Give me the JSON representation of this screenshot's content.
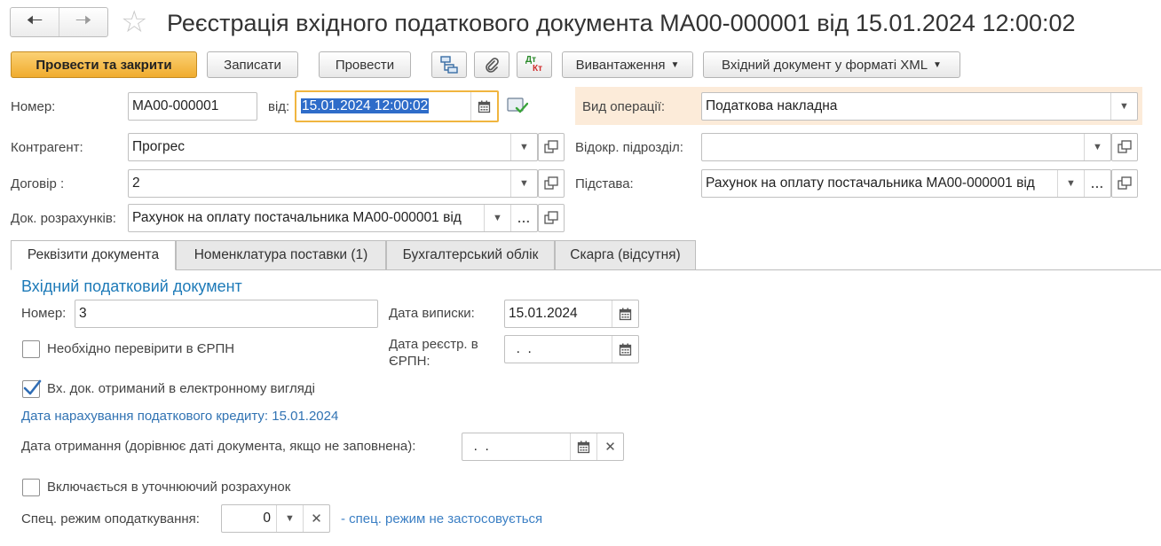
{
  "window": {
    "title": "Реєстрація вхідного податкового документа МА00-000001 від 15.01.2024 12:00:02"
  },
  "toolbar": {
    "post_close": "Провести та закрити",
    "save": "Записати",
    "post": "Провести",
    "upload": "Вивантаження",
    "xml": "Вхідний документ у форматі XML",
    "dtkt_top": "Дт",
    "dtkt_bottom": "Кт"
  },
  "header": {
    "number_label": "Номер:",
    "number_value": "МА00-000001",
    "from_label": "від:",
    "date_value": "15.01.2024 12:00:02",
    "operation_label": "Вид операції:",
    "operation_value": "Податкова накладна",
    "counterparty_label": "Контрагент:",
    "counterparty_value": "Прогрес",
    "branch_label": "Відокр. підрозділ:",
    "branch_value": "",
    "contract_label": "Договір :",
    "contract_value": "2",
    "basis_label": "Підстава:",
    "basis_value": "Рахунок на оплату постачальника МА00-000001 від",
    "settlement_label": "Док. розрахунків:",
    "settlement_value": "Рахунок на оплату постачальника МА00-000001 від"
  },
  "tabs": [
    {
      "label": "Реквізити документа",
      "active": true
    },
    {
      "label": "Номенклатура поставки (1)",
      "active": false
    },
    {
      "label": "Бухгалтерський облік",
      "active": false
    },
    {
      "label": "Скарга (відсутня)",
      "active": false
    }
  ],
  "details": {
    "section_title": "Вхідний податковий документ",
    "number_label": "Номер:",
    "number_value": "3",
    "issue_date_label": "Дата виписки:",
    "issue_date_value": "15.01.2024",
    "check_erpn_label": "Необхідно перевірити в ЄРПН",
    "check_erpn_checked": false,
    "reg_date_label_1": "Дата реєстр. в",
    "reg_date_label_2": "ЄРПН:",
    "reg_date_value": "  .  .",
    "electronic_label": "Вх. док. отриманий в електронному вигляді",
    "electronic_checked": true,
    "credit_date_text": "Дата нарахування податкового кредиту: 15.01.2024",
    "received_label": "Дата отримання (дорівнює даті документа, якщо не заповнена):",
    "received_value": "  .  .",
    "clarifying_label": "Включається в уточнюючий розрахунок",
    "clarifying_checked": false,
    "tax_mode_label": "Спец. режим оподаткування:",
    "tax_mode_value": "0",
    "tax_mode_note": "- спец. режим не застосовується"
  }
}
